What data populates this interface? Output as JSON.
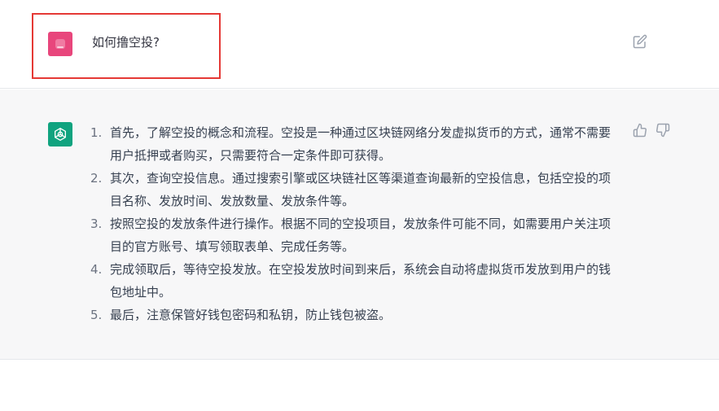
{
  "user_message": {
    "text": "如何撸空投?"
  },
  "assistant_message": {
    "items": [
      {
        "num": "1.",
        "text": "首先，了解空投的概念和流程。空投是一种通过区块链网络分发虚拟货币的方式，通常不需要用户抵押或者购买，只需要符合一定条件即可获得。"
      },
      {
        "num": "2.",
        "text": "其次，查询空投信息。通过搜索引擎或区块链社区等渠道查询最新的空投信息，包括空投的项目名称、发放时间、发放数量、发放条件等。"
      },
      {
        "num": "3.",
        "text": "按照空投的发放条件进行操作。根据不同的空投项目，发放条件可能不同，如需要用户关注项目的官方账号、填写领取表单、完成任务等。"
      },
      {
        "num": "4.",
        "text": "完成领取后，等待空投发放。在空投发放时间到来后，系统会自动将虚拟货币发放到用户的钱包地址中。"
      },
      {
        "num": "5.",
        "text": "最后，注意保管好钱包密码和私钥，防止钱包被盗。"
      }
    ]
  },
  "colors": {
    "user_avatar": "#e8467c",
    "assistant_avatar": "#10a37f",
    "highlight": "#e53935",
    "assistant_bg": "#f7f7f8"
  },
  "icons": {
    "edit": "edit-icon",
    "thumbs_up": "thumbs-up-icon",
    "thumbs_down": "thumbs-down-icon",
    "openai_logo": "openai-logo-icon"
  }
}
